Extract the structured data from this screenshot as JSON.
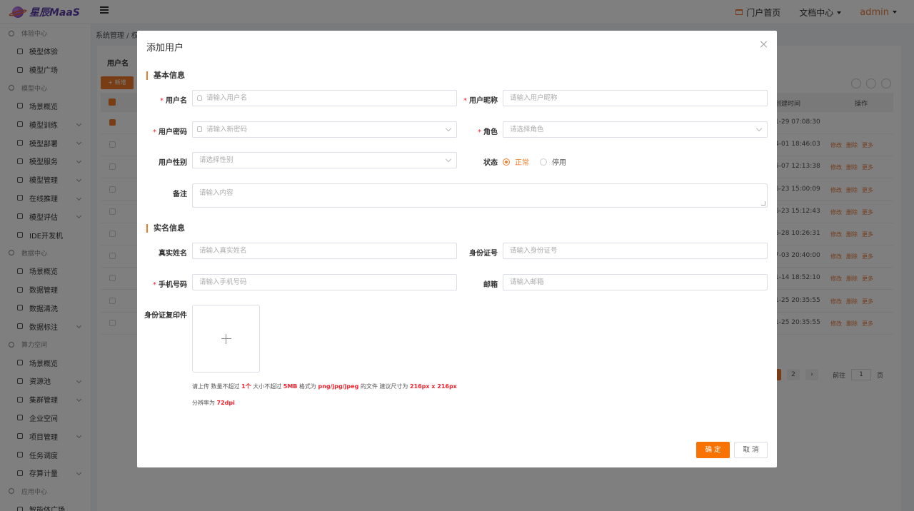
{
  "header": {
    "logo_text": "星辰MaaS",
    "portal_label": "门户首页",
    "docs_label": "文档中心",
    "user_label": "admin"
  },
  "sidebar": {
    "groups": [
      {
        "label": "体验中心",
        "items": [
          "模型体验",
          "模型广场"
        ]
      },
      {
        "label": "模型中心",
        "items": [
          "场景概览",
          "模型训练",
          "模型部署",
          "模型服务",
          "模型管理",
          "在线推理",
          "模型评估",
          "IDE开发机"
        ]
      },
      {
        "label": "数据中心",
        "items": [
          "场景概览",
          "数据管理",
          "数据清洗",
          "数据标注"
        ]
      },
      {
        "label": "算力空间",
        "items": [
          "场景概览",
          "资源池",
          "集群管理",
          "企业空间",
          "项目管理",
          "任务调度",
          "存算计量"
        ]
      },
      {
        "label": "应用中心",
        "items": [
          "智能体广场"
        ]
      }
    ]
  },
  "background": {
    "breadcrumb": "系统管理 / 权",
    "table_label": "用户名",
    "add_button": "+ 新增",
    "col_time": "创建时间",
    "col_ops": "操作",
    "rows": [
      {
        "time": "1-29 07:08:30",
        "ops": false,
        "checked": true
      },
      {
        "time": "4-01 18:46:03",
        "ops": true,
        "checked": false
      },
      {
        "time": "5-07 12:13:38",
        "ops": true,
        "checked": false
      },
      {
        "time": "6-23 15:00:09",
        "ops": true,
        "checked": false
      },
      {
        "time": "6-23 15:12:43",
        "ops": true,
        "checked": false
      },
      {
        "time": "6-28 10:26:31",
        "ops": true,
        "checked": false
      },
      {
        "time": "7-03 20:40:00",
        "ops": true,
        "checked": false
      },
      {
        "time": "1-14 18:52:10",
        "ops": true,
        "checked": false
      },
      {
        "time": "1-25 20:35:55",
        "ops": true,
        "checked": false
      },
      {
        "time": "1-25 20:35:55",
        "ops": true,
        "checked": false
      }
    ],
    "op_labels": [
      "修改",
      "删除",
      "更多"
    ],
    "pager": {
      "page1": "1",
      "page2": "2",
      "goto_label": "前往",
      "goto_value": "1",
      "page_suffix": "页"
    }
  },
  "dialog": {
    "title": "添加用户",
    "section_basic": "基本信息",
    "section_realname": "实名信息",
    "fields": {
      "username": {
        "label": "用户名",
        "placeholder": "请输入用户名"
      },
      "nickname": {
        "label": "用户昵称",
        "placeholder": "请输入用户昵称"
      },
      "password": {
        "label": "用户密码",
        "placeholder": "请输入新密码"
      },
      "role": {
        "label": "角色",
        "placeholder": "请选择角色"
      },
      "gender": {
        "label": "用户性别",
        "placeholder": "请选择性别"
      },
      "status": {
        "label": "状态",
        "opt_normal": "正常",
        "opt_disabled": "停用",
        "selected": "正常"
      },
      "remark": {
        "label": "备注",
        "placeholder": "请输入内容"
      },
      "realname": {
        "label": "真实姓名",
        "placeholder": "请输入真实姓名"
      },
      "idnumber": {
        "label": "身份证号",
        "placeholder": "请输入身份证号"
      },
      "phone": {
        "label": "手机号码",
        "placeholder": "请输入手机号码"
      },
      "email": {
        "label": "邮箱",
        "placeholder": "请输入邮箱"
      },
      "idcopy": {
        "label": "身份证复印件"
      }
    },
    "hint": {
      "p1": "请上传 数量不超过 ",
      "count": "1个",
      "p2": " 大小不超过 ",
      "size": "5MB",
      "p3": " 格式为 ",
      "formats": "png/jpg/jpeg",
      "p4": " 的文件 建议尺寸为 ",
      "dims": "216px x 216px",
      "p5": " 分辨率为 ",
      "dpi": "72dpi"
    },
    "ok_label": "确 定",
    "cancel_label": "取 消"
  },
  "colors": {
    "accent": "#f87304",
    "required": "#f5222d"
  }
}
